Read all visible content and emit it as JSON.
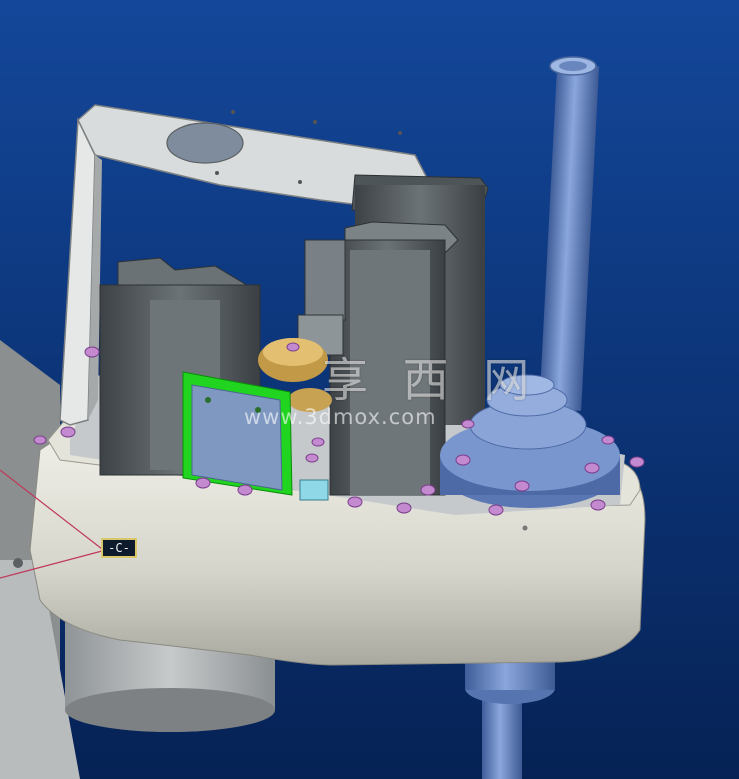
{
  "annotation": {
    "tag_label": "-C-"
  },
  "watermark": {
    "chinese_text": "享 西 网",
    "url_text": "www.3dmox.com"
  },
  "colors": {
    "background_top": "#14479a",
    "background_bottom": "#062255",
    "housing": "#d9d9cf",
    "motor": "#5b6266",
    "shaft": "#6b87c1",
    "bracket": "#cfd2d4",
    "bolt": "#c48ad0",
    "green_board": "#1ad41a",
    "annotation_line": "#c0395a"
  }
}
